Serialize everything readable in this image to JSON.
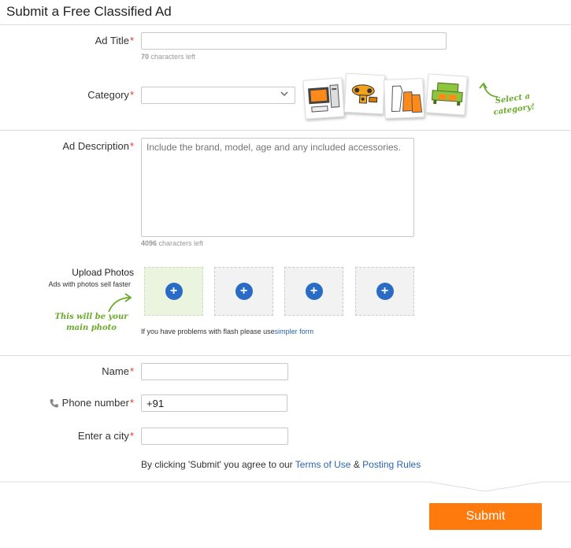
{
  "page_title": "Submit a Free Classified Ad",
  "ad_title": {
    "label": "Ad Title",
    "required_mark": "*",
    "value": "",
    "chars_left_count": "70",
    "chars_left_text": " characters left"
  },
  "category": {
    "label": "Category",
    "required_mark": "*",
    "selected": "",
    "illustrations": [
      "computer-icon",
      "toy-icon",
      "clothing-icon",
      "sofa-icon"
    ],
    "callout": "Select a category!"
  },
  "description": {
    "label": "Ad Description",
    "required_mark": "*",
    "placeholder": "Include the brand, model, age and any included accessories.",
    "chars_left_count": "4096",
    "chars_left_text": " characters left"
  },
  "photos": {
    "label": "Upload Photos",
    "sublabel": "Ads with photos sell faster",
    "main_note_line1": "This will be your",
    "main_note_line2": "main photo",
    "plus": "+",
    "flash_text": "If you have problems with flash please use",
    "flash_link": "simpler form"
  },
  "name": {
    "label": "Name",
    "required_mark": "*",
    "value": ""
  },
  "phone": {
    "label": "Phone number",
    "required_mark": "*",
    "value": "+91",
    "icon": "phone-icon"
  },
  "city": {
    "label": "Enter a city",
    "required_mark": "*",
    "value": ""
  },
  "terms": {
    "prefix": "By clicking 'Submit' you agree to our ",
    "terms_link": "Terms of Use",
    "amp": " & ",
    "rules_link": "Posting Rules"
  },
  "submit_label": "Submit",
  "colors": {
    "accent": "#ff7a0d",
    "link": "#2a64b3",
    "required": "#e53935",
    "note_green": "#6aaa2a",
    "plus_blue": "#2a6bc6"
  }
}
